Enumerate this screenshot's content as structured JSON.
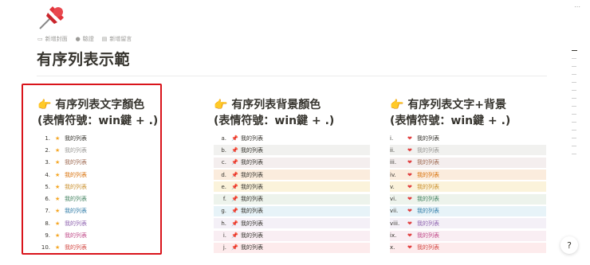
{
  "page": {
    "title": "有序列表示範",
    "icon": "pushpin-icon",
    "meta": [
      {
        "icon": "image-icon",
        "label": "新增封面"
      },
      {
        "icon": "check-circle-icon",
        "label": "驗證"
      },
      {
        "icon": "comment-icon",
        "label": "新增留言"
      }
    ]
  },
  "columns": [
    {
      "heading_line1": "有序列表文字顏色",
      "heading_line2": "(表情符號：win鍵 + .)",
      "emoji": "👉",
      "items": [
        {
          "marker": "1.",
          "text": "我的列表",
          "color": "#37352f"
        },
        {
          "marker": "2.",
          "text": "我的列表",
          "color": "#9b9a97"
        },
        {
          "marker": "3.",
          "text": "我的列表",
          "color": "#9f6b53"
        },
        {
          "marker": "4.",
          "text": "我的列表",
          "color": "#d9730d"
        },
        {
          "marker": "5.",
          "text": "我的列表",
          "color": "#cb912f"
        },
        {
          "marker": "6.",
          "text": "我的列表",
          "color": "#448361"
        },
        {
          "marker": "7.",
          "text": "我的列表",
          "color": "#337ea9"
        },
        {
          "marker": "8.",
          "text": "我的列表",
          "color": "#9065b0"
        },
        {
          "marker": "9.",
          "text": "我的列表",
          "color": "#c14c8a"
        },
        {
          "marker": "10.",
          "text": "我的列表",
          "color": "#d44c47"
        }
      ]
    },
    {
      "heading_line1": "有序列表背景顏色",
      "heading_line2": "(表情符號：win鍵 + .)",
      "emoji": "👉",
      "items": [
        {
          "marker": "a.",
          "text": "我的列表",
          "bg": "#ffffff"
        },
        {
          "marker": "b.",
          "text": "我的列表",
          "bg": "#f1f1ef"
        },
        {
          "marker": "c.",
          "text": "我的列表",
          "bg": "#f4eeee"
        },
        {
          "marker": "d.",
          "text": "我的列表",
          "bg": "#fbecdd"
        },
        {
          "marker": "e.",
          "text": "我的列表",
          "bg": "#fbf3db"
        },
        {
          "marker": "f.",
          "text": "我的列表",
          "bg": "#edf3ec"
        },
        {
          "marker": "g.",
          "text": "我的列表",
          "bg": "#e7f3f8"
        },
        {
          "marker": "h.",
          "text": "我的列表",
          "bg": "#f4f0f7"
        },
        {
          "marker": "i.",
          "text": "我的列表",
          "bg": "#f9eef3"
        },
        {
          "marker": "j.",
          "text": "我的列表",
          "bg": "#fdebec"
        }
      ]
    },
    {
      "heading_line1": "有序列表文字+背景",
      "heading_line2": "(表情符號：win鍵 + .)",
      "emoji": "👉",
      "items": [
        {
          "marker": "i.",
          "text": "我的列表",
          "color": "#37352f",
          "bg": "#ffffff"
        },
        {
          "marker": "ii.",
          "text": "我的列表",
          "color": "#9b9a97",
          "bg": "#f1f1ef"
        },
        {
          "marker": "iii.",
          "text": "我的列表",
          "color": "#9f6b53",
          "bg": "#f4eeee"
        },
        {
          "marker": "iv.",
          "text": "我的列表",
          "color": "#d9730d",
          "bg": "#fbecdd"
        },
        {
          "marker": "v.",
          "text": "我的列表",
          "color": "#cb912f",
          "bg": "#fbf3db"
        },
        {
          "marker": "vi.",
          "text": "我的列表",
          "color": "#448361",
          "bg": "#edf3ec"
        },
        {
          "marker": "vii.",
          "text": "我的列表",
          "color": "#337ea9",
          "bg": "#e7f3f8"
        },
        {
          "marker": "viii.",
          "text": "我的列表",
          "color": "#9065b0",
          "bg": "#f4f0f7"
        },
        {
          "marker": "ix.",
          "text": "我的列表",
          "color": "#c14c8a",
          "bg": "#f9eef3"
        },
        {
          "marker": "x.",
          "text": "我的列表",
          "color": "#d44c47",
          "bg": "#fdebec"
        }
      ]
    }
  ],
  "help_button": {
    "label": "?"
  }
}
